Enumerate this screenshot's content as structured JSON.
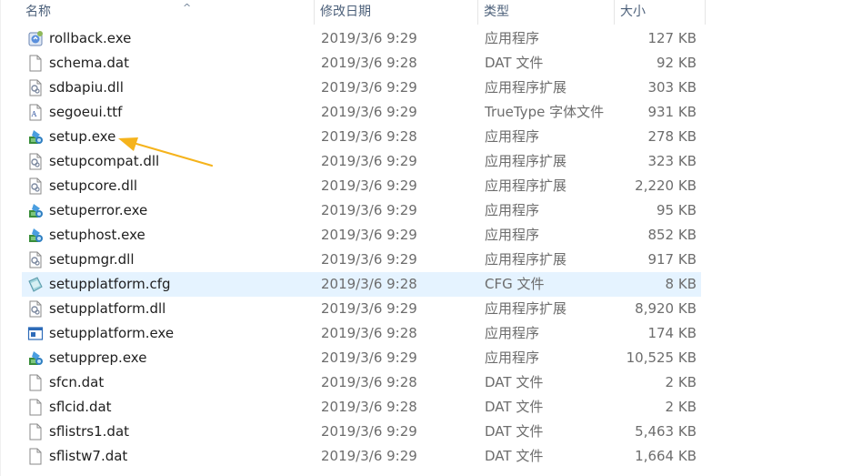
{
  "columns": {
    "name": "名称",
    "date": "修改日期",
    "type": "类型",
    "size": "大小"
  },
  "annotation_color": "#f5b31c",
  "files": [
    {
      "name": "rollback.exe",
      "date": "2019/3/6 9:29",
      "type": "应用程序",
      "size": "127 KB",
      "icon": "rollback-app-icon"
    },
    {
      "name": "schema.dat",
      "date": "2019/3/6 9:28",
      "type": "DAT 文件",
      "size": "92 KB",
      "icon": "blank-file-icon"
    },
    {
      "name": "sdbapiu.dll",
      "date": "2019/3/6 9:29",
      "type": "应用程序扩展",
      "size": "303 KB",
      "icon": "dll-gear-icon"
    },
    {
      "name": "segoeui.ttf",
      "date": "2019/3/6 9:29",
      "type": "TrueType 字体文件",
      "size": "931 KB",
      "icon": "font-file-icon"
    },
    {
      "name": "setup.exe",
      "date": "2019/3/6 9:28",
      "type": "应用程序",
      "size": "278 KB",
      "icon": "setup-app-icon"
    },
    {
      "name": "setupcompat.dll",
      "date": "2019/3/6 9:29",
      "type": "应用程序扩展",
      "size": "323 KB",
      "icon": "dll-gear-icon"
    },
    {
      "name": "setupcore.dll",
      "date": "2019/3/6 9:29",
      "type": "应用程序扩展",
      "size": "2,220 KB",
      "icon": "dll-gear-icon"
    },
    {
      "name": "setuperror.exe",
      "date": "2019/3/6 9:29",
      "type": "应用程序",
      "size": "95 KB",
      "icon": "setup-app-icon"
    },
    {
      "name": "setuphost.exe",
      "date": "2019/3/6 9:29",
      "type": "应用程序",
      "size": "852 KB",
      "icon": "setup-app-icon"
    },
    {
      "name": "setupmgr.dll",
      "date": "2019/3/6 9:29",
      "type": "应用程序扩展",
      "size": "917 KB",
      "icon": "dll-gear-icon"
    },
    {
      "name": "setupplatform.cfg",
      "date": "2019/3/6 9:28",
      "type": "CFG 文件",
      "size": "8 KB",
      "icon": "cfg-file-icon"
    },
    {
      "name": "setupplatform.dll",
      "date": "2019/3/6 9:29",
      "type": "应用程序扩展",
      "size": "8,920 KB",
      "icon": "dll-gear-icon"
    },
    {
      "name": "setupplatform.exe",
      "date": "2019/3/6 9:28",
      "type": "应用程序",
      "size": "174 KB",
      "icon": "window-app-icon"
    },
    {
      "name": "setupprep.exe",
      "date": "2019/3/6 9:29",
      "type": "应用程序",
      "size": "10,525 KB",
      "icon": "setup-app-icon"
    },
    {
      "name": "sfcn.dat",
      "date": "2019/3/6 9:28",
      "type": "DAT 文件",
      "size": "2 KB",
      "icon": "blank-file-icon"
    },
    {
      "name": "sflcid.dat",
      "date": "2019/3/6 9:28",
      "type": "DAT 文件",
      "size": "2 KB",
      "icon": "blank-file-icon"
    },
    {
      "name": "sflistrs1.dat",
      "date": "2019/3/6 9:29",
      "type": "DAT 文件",
      "size": "5,463 KB",
      "icon": "blank-file-icon"
    },
    {
      "name": "sflistw7.dat",
      "date": "2019/3/6 9:29",
      "type": "DAT 文件",
      "size": "1,664 KB",
      "icon": "blank-file-icon"
    }
  ],
  "hover_row": 10,
  "annotated_row": 4
}
